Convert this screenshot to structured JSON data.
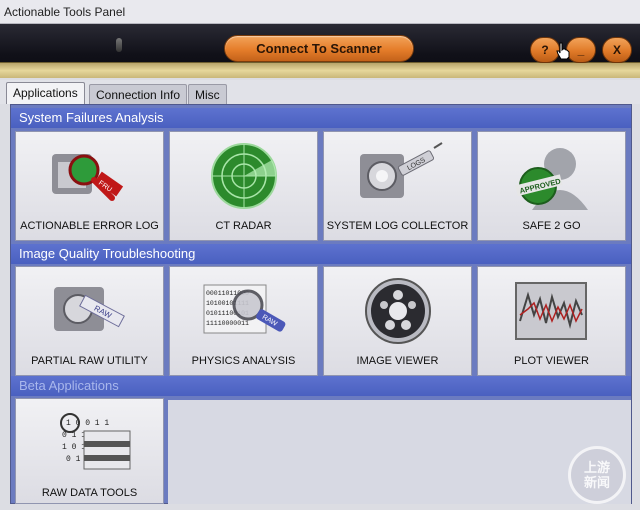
{
  "window": {
    "title": "Actionable Tools Panel"
  },
  "header": {
    "connect_label": "Connect To Scanner",
    "help_label": "?",
    "minimize_label": "_",
    "close_label": "X"
  },
  "tabs": [
    {
      "label": "Applications",
      "active": true
    },
    {
      "label": "Connection Info",
      "active": false
    },
    {
      "label": "Misc",
      "active": false
    }
  ],
  "sections": [
    {
      "title": "System Failures Analysis",
      "tiles": [
        {
          "label": "ACTIONABLE ERROR LOG",
          "icon": "error-log-magnifier-icon",
          "badge": "FRU"
        },
        {
          "label": "CT RADAR",
          "icon": "radar-icon"
        },
        {
          "label": "SYSTEM LOG COLLECTOR",
          "icon": "log-collector-icon",
          "badge": "LOGS"
        },
        {
          "label": "SAFE 2 GO",
          "icon": "approved-person-icon",
          "badge": "APPROVED"
        }
      ]
    },
    {
      "title": "Image Quality Troubleshooting",
      "tiles": [
        {
          "label": "PARTIAL RAW UTILITY",
          "icon": "raw-utility-icon",
          "badge": "RAW"
        },
        {
          "label": "PHYSICS ANALYSIS",
          "icon": "physics-analysis-icon",
          "badge": "RAW"
        },
        {
          "label": "IMAGE VIEWER",
          "icon": "image-viewer-icon"
        },
        {
          "label": "PLOT VIEWER",
          "icon": "plot-viewer-icon"
        }
      ]
    },
    {
      "title": "Beta Applications",
      "tiles": [
        {
          "label": "RAW DATA TOOLS",
          "icon": "raw-data-tools-icon"
        }
      ]
    }
  ],
  "watermark": {
    "line1": "上游",
    "line2": "新闻"
  },
  "colors": {
    "accent_orange": "#e57d2a",
    "section_blue": "#4a60c0",
    "header_dark": "#101018",
    "gold": "#e6d79c"
  }
}
